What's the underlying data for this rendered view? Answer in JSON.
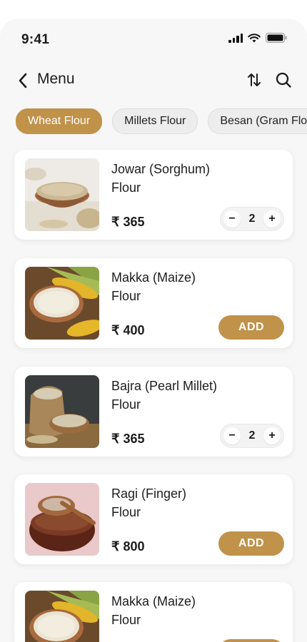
{
  "status": {
    "time": "9:41"
  },
  "header": {
    "title": "Menu"
  },
  "categories": [
    {
      "label": "Wheat Flour",
      "active": true
    },
    {
      "label": "Millets Flour",
      "active": false
    },
    {
      "label": "Besan (Gram Flour)",
      "active": false
    }
  ],
  "products": [
    {
      "name_line1": "Jowar (Sorghum)",
      "name_line2": "Flour",
      "price": "₹ 365",
      "quantity": "2",
      "in_cart": true,
      "image": "jowar-flour-image"
    },
    {
      "name_line1": "Makka (Maize)",
      "name_line2": "Flour",
      "price": "₹ 400",
      "add_label": "ADD",
      "in_cart": false,
      "image": "maize-flour-image"
    },
    {
      "name_line1": "Bajra (Pearl Millet)",
      "name_line2": "Flour",
      "price": "₹ 365",
      "quantity": "2",
      "in_cart": true,
      "image": "bajra-flour-image"
    },
    {
      "name_line1": "Ragi (Finger)",
      "name_line2": "Flour",
      "price": "₹ 800",
      "add_label": "ADD",
      "in_cart": false,
      "image": "ragi-flour-image"
    },
    {
      "name_line1": "Makka (Maize)",
      "name_line2": "Flour",
      "price": "",
      "add_label": "",
      "in_cart": false,
      "image": "maize-flour-image"
    }
  ],
  "stepper": {
    "minus": "−",
    "plus": "+"
  },
  "colors": {
    "accent": "#c0924a",
    "background": "#f7f7f7",
    "card": "#ffffff"
  }
}
